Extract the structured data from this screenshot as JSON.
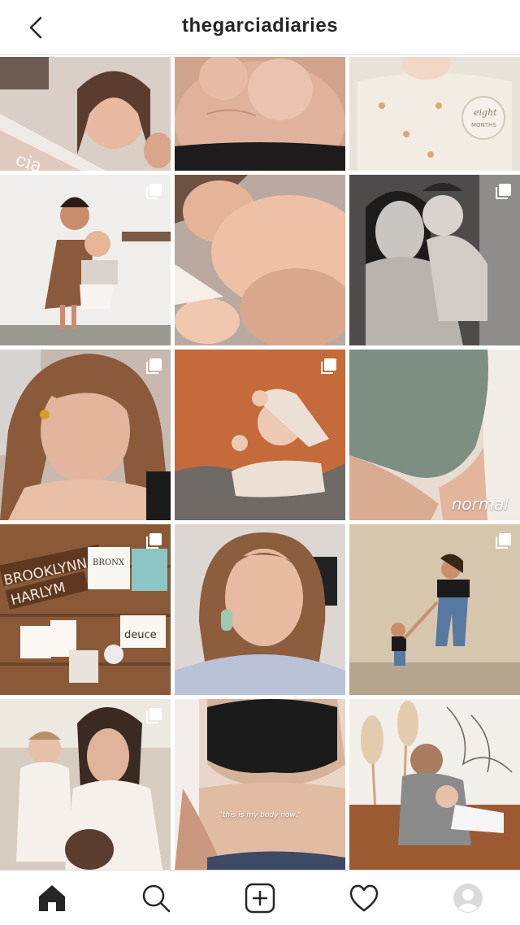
{
  "header": {
    "username": "thegarciadiaries",
    "back_icon": "chevron-left-icon"
  },
  "posts": [
    {
      "id": "post-1",
      "description": "family holding magazine",
      "multi": false
    },
    {
      "id": "post-2",
      "description": "baby on belly",
      "multi": false
    },
    {
      "id": "post-3",
      "description": "baby eight months",
      "multi": false
    },
    {
      "id": "post-4",
      "description": "two sisters",
      "multi": true
    },
    {
      "id": "post-5",
      "description": "sleeping baby",
      "multi": false
    },
    {
      "id": "post-6",
      "description": "mother holding baby",
      "multi": true
    },
    {
      "id": "post-7",
      "description": "selfie",
      "multi": true
    },
    {
      "id": "post-8",
      "description": "baby sleeping on orange blanket",
      "multi": true
    },
    {
      "id": "post-9",
      "description": "green underwear",
      "multi": false,
      "caption": "normal"
    },
    {
      "id": "post-10",
      "description": "name signs flat lay",
      "multi": true
    },
    {
      "id": "post-11",
      "description": "selfie earring",
      "multi": false
    },
    {
      "id": "post-12",
      "description": "mother walking with toddler",
      "multi": true
    },
    {
      "id": "post-13",
      "description": "mother with daughters",
      "multi": true
    },
    {
      "id": "post-14",
      "description": "body positivity",
      "multi": false,
      "caption": "\"this is my body now.\""
    },
    {
      "id": "post-15",
      "description": "mother on couch with baby",
      "multi": false
    }
  ],
  "overlays": {
    "normal": "normal",
    "body_now": "\"this is my body now.\""
  },
  "tabbar": {
    "items": [
      "home-icon",
      "search-icon",
      "new-post-icon",
      "heart-icon",
      "profile-icon"
    ]
  }
}
